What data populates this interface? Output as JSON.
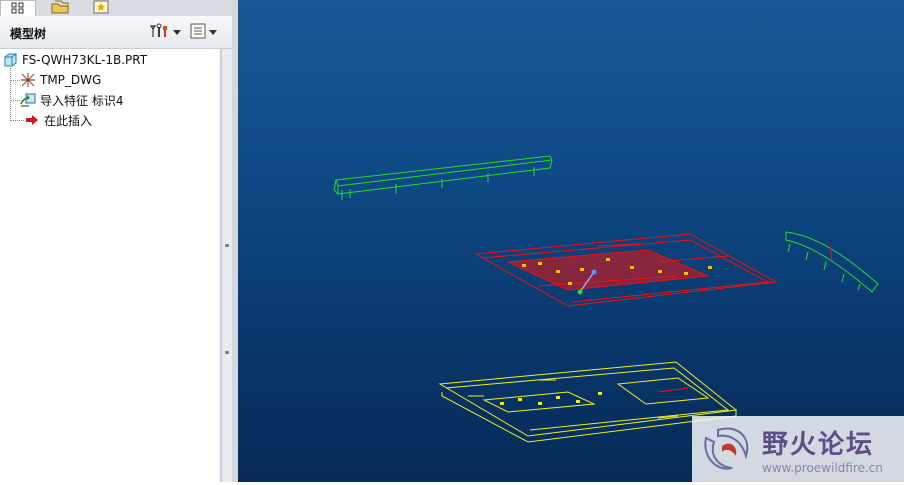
{
  "panel": {
    "title": "模型树",
    "tree": {
      "root": "FS-QWH73KL-1B.PRT",
      "items": [
        {
          "label": "TMP_DWG",
          "icon": "datum-coordinate-icon"
        },
        {
          "label": "导入特征 标识4",
          "icon": "import-feature-icon"
        },
        {
          "label": "在此插入",
          "icon": "insert-here-arrow-icon"
        }
      ]
    }
  },
  "watermark": {
    "name": "野火论坛",
    "url": "www.proewildfire.cn"
  },
  "colors": {
    "viewport_top": "#1a5796",
    "viewport_bottom": "#062a57",
    "part_green": "#22dd22",
    "part_red": "#ee1111",
    "part_yellow": "#eeee22"
  }
}
